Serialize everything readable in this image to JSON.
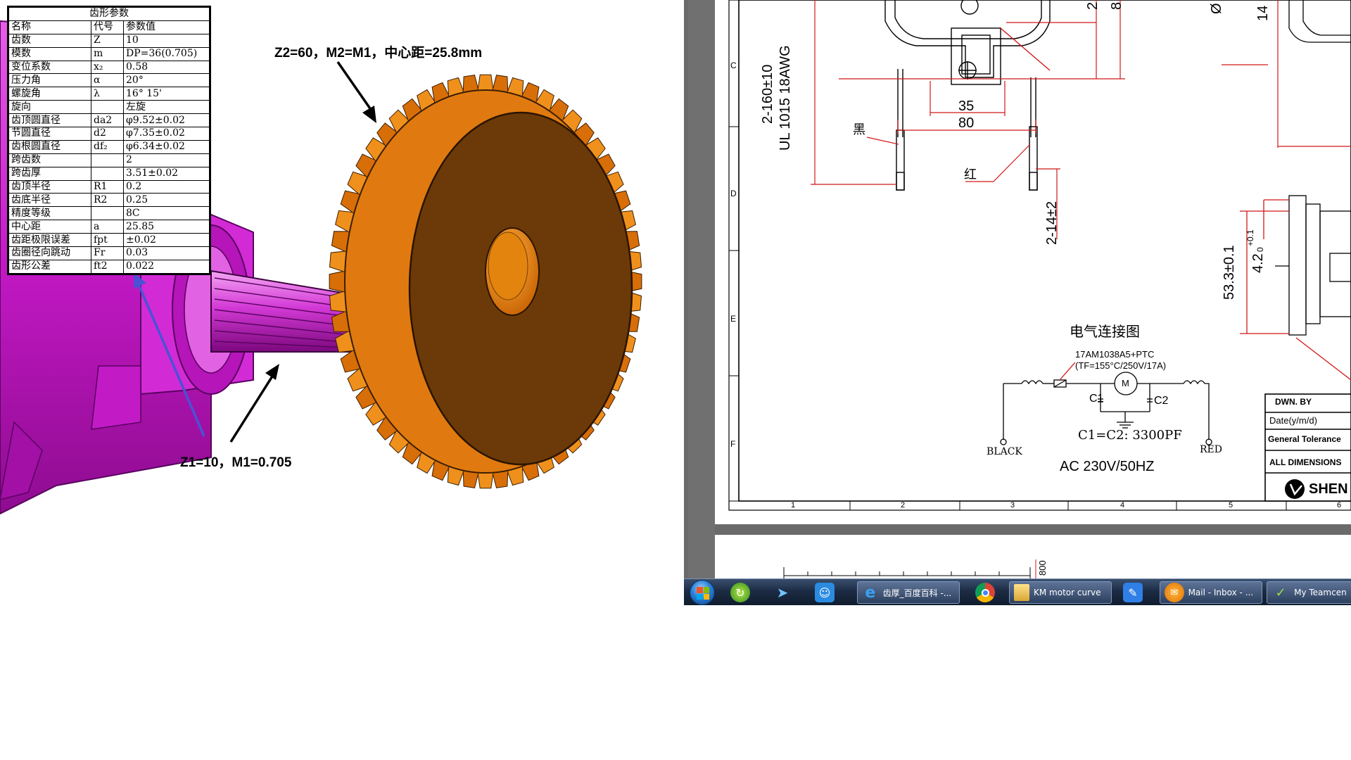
{
  "gear_figure": {
    "annotation_z2": "Z2=60，M2=M1，中心距=25.8mm",
    "annotation_z1": "Z1=10，M1=0.705",
    "table": {
      "title": "齿形参数",
      "header": [
        "名称",
        "代号",
        "参数值"
      ],
      "rows": [
        [
          "齿数",
          "Z",
          "10"
        ],
        [
          "模数",
          "m",
          "DP=36(0.705)"
        ],
        [
          "变位系数",
          "x₂",
          "0.58"
        ],
        [
          "压力角",
          "α",
          "20°"
        ],
        [
          "螺旋角",
          "λ",
          "16° 15'"
        ],
        [
          "旋向",
          "",
          "左旋"
        ],
        [
          "齿顶圆直径",
          "da2",
          "φ9.52±0.02"
        ],
        [
          "节圆直径",
          "d2",
          "φ7.35±0.02"
        ],
        [
          "齿根圆直径",
          "df₂",
          "φ6.34±0.02"
        ],
        [
          "跨齿数",
          "",
          "2"
        ],
        [
          "跨齿厚",
          "",
          "3.51±0.02"
        ],
        [
          "齿顶半径",
          "R1",
          "0.2"
        ],
        [
          "齿底半径",
          "R2",
          "0.25"
        ],
        [
          "精度等级",
          "",
          "8C"
        ],
        [
          "中心距",
          "a",
          "25.85"
        ],
        [
          "齿距极限误差",
          "fpt",
          "±0.02"
        ],
        [
          "齿圈径向跳动",
          "Fr",
          "0.03"
        ],
        [
          "齿形公差",
          "ft2",
          "0.022"
        ]
      ]
    }
  },
  "drawing": {
    "row_labels": [
      "C",
      "D",
      "E",
      "F"
    ],
    "col_labels": [
      "1",
      "2",
      "3",
      "4",
      "5",
      "6"
    ],
    "dim_35": "35",
    "dim_80": "80",
    "dim_lead_len": "2-160±10",
    "dim_wire": "UL 1015 18AWG",
    "dim_strip": "2-14±2",
    "dim_53": "53.3±0.1",
    "dim_4_2": "4.2",
    "dim_4_2_tol": "+0.1",
    "dim_4_2_tol2": "0",
    "dim_14": "14",
    "dim_phi": "Ø",
    "dim_top2": "2",
    "dim_top8": "8",
    "dim_bottom": "800",
    "label_black_cn": "黑",
    "label_red_cn": "红",
    "schematic_title": "电气连接图",
    "ptc_label": "17AM1038A5+PTC",
    "ptc_rating": "(TF=155°C/250V/17A)",
    "motor_symbol": "M",
    "c1": "C1",
    "c2": "C2",
    "cap_value": "C1=C2: 3300PF",
    "term_black": "BLACK",
    "term_red": "RED",
    "supply": "AC 230V/50HZ",
    "title_block": {
      "drawn_by": "DWN. BY",
      "date": "Date(y/m/d)",
      "tolerance": "General Tolerance",
      "dimensions": "ALL DIMENSIONS",
      "company": "SHEN"
    }
  },
  "taskbar": {
    "tasks": [
      {
        "icon": "internet-explorer-icon",
        "label": "齿厚_百度百科 -..."
      },
      {
        "icon": "folder-icon",
        "label": "KM motor curve"
      },
      {
        "icon": "mail-icon",
        "label": "Mail - Inbox - ..."
      },
      {
        "icon": "teamcenter-icon",
        "label": "My Teamcen"
      }
    ],
    "colors": {
      "bar": "#1c2c44",
      "task_button": "#4a6088"
    }
  },
  "colors": {
    "gear_orange": "#e07a10",
    "gear_face": "#6b3a08",
    "pinion_magenta": "#d21ad6",
    "annotation_blue": "#4a52d6",
    "window_gray": "#6a6a6a"
  }
}
